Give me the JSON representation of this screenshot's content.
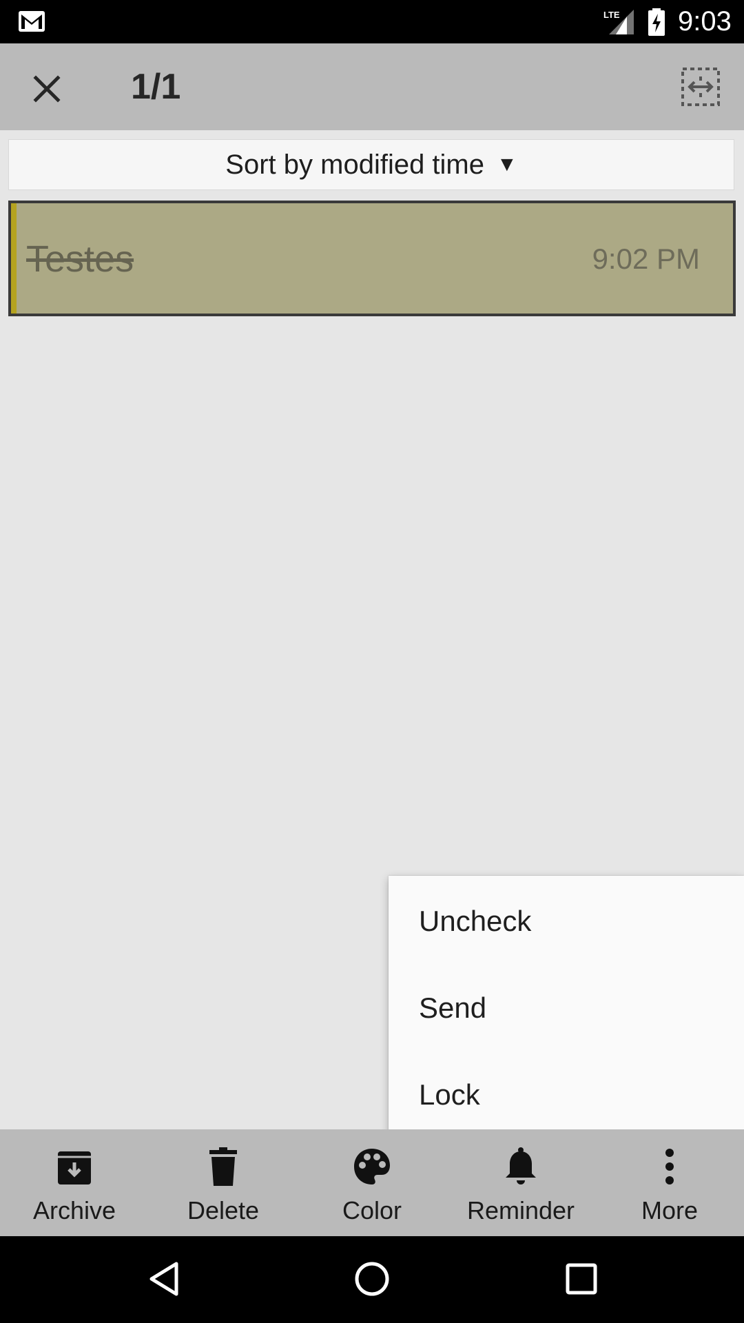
{
  "status_bar": {
    "time": "9:03",
    "network": "LTE"
  },
  "toolbar": {
    "selection_count": "1/1"
  },
  "sort": {
    "label": "Sort by modified time"
  },
  "notes": [
    {
      "title": "Testes",
      "time": "9:02 PM",
      "checked": true,
      "color": "#aca985"
    }
  ],
  "popup_menu": {
    "items": [
      "Uncheck",
      "Send",
      "Lock"
    ]
  },
  "bottom_actions": [
    {
      "label": "Archive",
      "icon": "archive-icon"
    },
    {
      "label": "Delete",
      "icon": "trash-icon"
    },
    {
      "label": "Color",
      "icon": "palette-icon"
    },
    {
      "label": "Reminder",
      "icon": "bell-icon"
    },
    {
      "label": "More",
      "icon": "more-vert-icon"
    }
  ]
}
